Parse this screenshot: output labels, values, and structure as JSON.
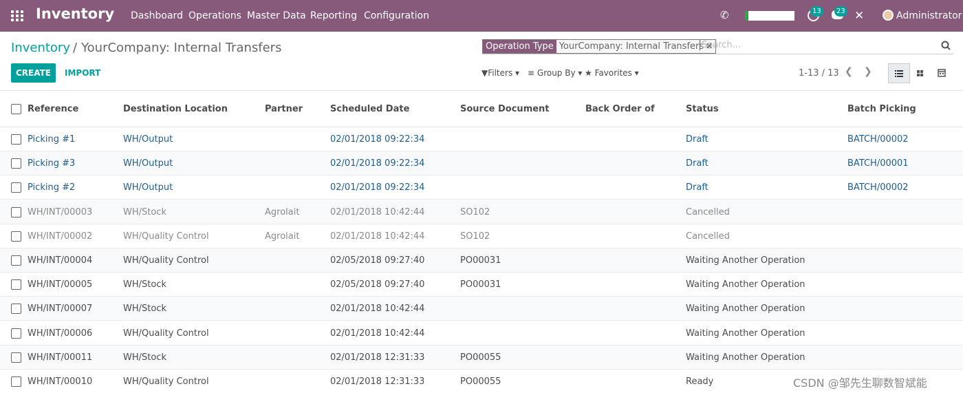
{
  "app": {
    "name": "Inventory",
    "menu": [
      "Dashboard",
      "Operations",
      "Master Data",
      "Reporting",
      "Configuration"
    ],
    "activity_count": "13",
    "message_count": "23",
    "user": "Administrator"
  },
  "breadcrumb": {
    "parent": "Inventory",
    "separator": "/",
    "current": "YourCompany: Internal Transfers"
  },
  "search": {
    "facet_category": "Operation Type",
    "facet_value": "YourCompany: Internal Transfers",
    "placeholder": "Search..."
  },
  "buttons": {
    "create": "CREATE",
    "import": "IMPORT"
  },
  "filters": {
    "filters": "Filters",
    "group_by": "Group By",
    "favorites": "Favorites"
  },
  "pager": {
    "range": "1-13 / 13"
  },
  "table": {
    "columns": [
      "Reference",
      "Destination Location",
      "Partner",
      "Scheduled Date",
      "Source Document",
      "Back Order of",
      "Status",
      "Batch Picking"
    ],
    "rows": [
      {
        "reference": "Picking #1",
        "destination": "WH/Output",
        "partner": "",
        "scheduled": "02/01/2018 09:22:34",
        "source": "",
        "backorder": "",
        "status": "Draft",
        "batch": "BATCH/00002",
        "state": "draft"
      },
      {
        "reference": "Picking #3",
        "destination": "WH/Output",
        "partner": "",
        "scheduled": "02/01/2018 09:22:34",
        "source": "",
        "backorder": "",
        "status": "Draft",
        "batch": "BATCH/00001",
        "state": "draft"
      },
      {
        "reference": "Picking #2",
        "destination": "WH/Output",
        "partner": "",
        "scheduled": "02/01/2018 09:22:34",
        "source": "",
        "backorder": "",
        "status": "Draft",
        "batch": "BATCH/00002",
        "state": "draft"
      },
      {
        "reference": "WH/INT/00003",
        "destination": "WH/Stock",
        "partner": "Agrolait",
        "scheduled": "02/01/2018 10:42:44",
        "source": "SO102",
        "backorder": "",
        "status": "Cancelled",
        "batch": "",
        "state": "cancel"
      },
      {
        "reference": "WH/INT/00002",
        "destination": "WH/Quality Control",
        "partner": "Agrolait",
        "scheduled": "02/01/2018 10:42:44",
        "source": "SO102",
        "backorder": "",
        "status": "Cancelled",
        "batch": "",
        "state": "cancel"
      },
      {
        "reference": "WH/INT/00004",
        "destination": "WH/Quality Control",
        "partner": "",
        "scheduled": "02/05/2018 09:27:40",
        "source": "PO00031",
        "backorder": "",
        "status": "Waiting Another Operation",
        "batch": "",
        "state": "waiting"
      },
      {
        "reference": "WH/INT/00005",
        "destination": "WH/Stock",
        "partner": "",
        "scheduled": "02/05/2018 09:27:40",
        "source": "PO00031",
        "backorder": "",
        "status": "Waiting Another Operation",
        "batch": "",
        "state": "waiting"
      },
      {
        "reference": "WH/INT/00007",
        "destination": "WH/Stock",
        "partner": "",
        "scheduled": "02/01/2018 10:42:44",
        "source": "",
        "backorder": "",
        "status": "Waiting Another Operation",
        "batch": "",
        "state": "waiting"
      },
      {
        "reference": "WH/INT/00006",
        "destination": "WH/Quality Control",
        "partner": "",
        "scheduled": "02/01/2018 10:42:44",
        "source": "",
        "backorder": "",
        "status": "Waiting Another Operation",
        "batch": "",
        "state": "waiting"
      },
      {
        "reference": "WH/INT/00011",
        "destination": "WH/Stock",
        "partner": "",
        "scheduled": "02/01/2018 12:31:33",
        "source": "PO00055",
        "backorder": "",
        "status": "Waiting Another Operation",
        "batch": "",
        "state": "waiting"
      },
      {
        "reference": "WH/INT/00010",
        "destination": "WH/Quality Control",
        "partner": "",
        "scheduled": "02/01/2018 12:31:33",
        "source": "PO00055",
        "backorder": "",
        "status": "Ready",
        "batch": "",
        "state": "ready"
      }
    ]
  },
  "watermark": "CSDN @邹先生聊数智斌能",
  "colors": {
    "navbar": "#875a7b",
    "accent": "#00a09d",
    "draft_link": "#1f5d8c",
    "cancelled_text": "#8a8a8a",
    "normal_text": "#4c4c4c"
  }
}
